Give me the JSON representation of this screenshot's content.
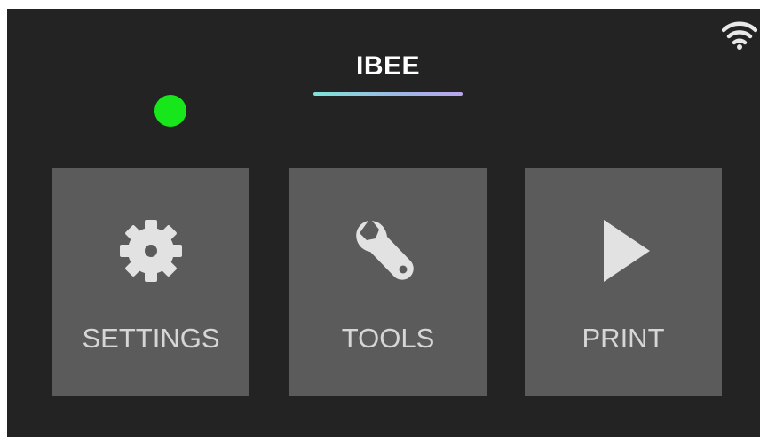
{
  "header": {
    "title": "IBEE",
    "status_color": "#17e61b",
    "wifi_icon": "wifi-icon"
  },
  "menu": {
    "tiles": [
      {
        "label": "SETTINGS",
        "icon": "gear-icon"
      },
      {
        "label": "TOOLS",
        "icon": "wrench-icon"
      },
      {
        "label": "PRINT",
        "icon": "play-icon"
      }
    ]
  },
  "colors": {
    "background": "#232323",
    "tile": "#5b5b5b",
    "tile_text": "#d6d6d6",
    "icon": "#e2e2e2"
  }
}
